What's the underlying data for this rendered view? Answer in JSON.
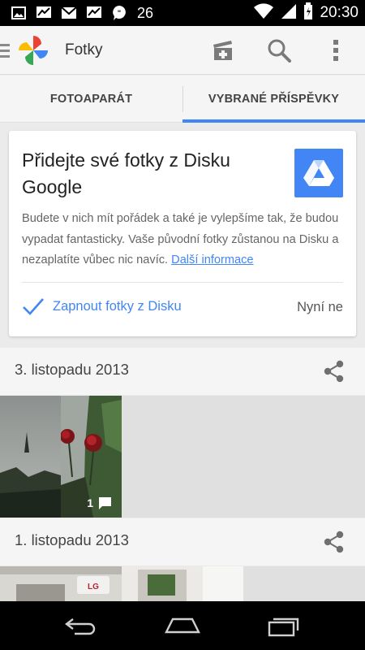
{
  "status_bar": {
    "notification_count": "26",
    "time": "20:30"
  },
  "app_bar": {
    "title": "Fotky"
  },
  "tabs": [
    {
      "label": "FOTOAPARÁT",
      "active": false
    },
    {
      "label": "VYBRANÉ PŘÍSPĚVKY",
      "active": true
    }
  ],
  "drive_card": {
    "title": "Přidejte své fotky z Disku Google",
    "body": "Budete v nich mít pořádek a také je vylepšíme tak, že budou vypadat fantasticky. Vaše původní fotky zůstanou na Disku a nezaplatíte vůbec nic navíc. ",
    "link": "Další informace",
    "confirm_label": "Zapnout fotky z Disku",
    "later_label": "Nyní ne",
    "accent": "#4285f4"
  },
  "days": [
    {
      "label": "3. listopadu 2013",
      "comment_count": "1"
    },
    {
      "label": "1. listopadu 2013"
    }
  ]
}
